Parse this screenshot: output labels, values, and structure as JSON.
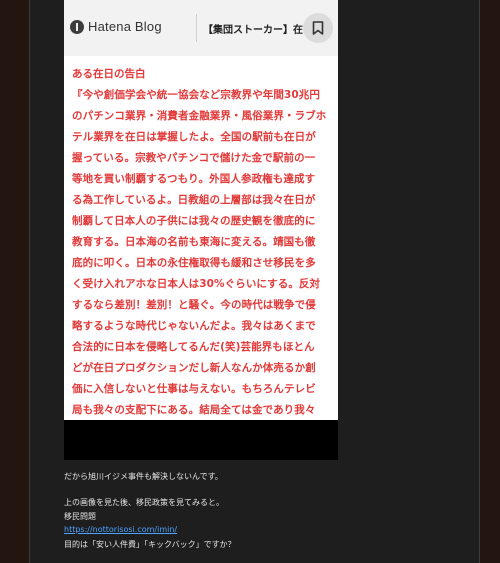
{
  "screenshot": {
    "logo_text": "Hatena Blog",
    "page_title": "【集団ストーカー】在日コ...",
    "notice_title": "ある在日の告白",
    "notice_lines": [
      "『今や創価学会や統一協会など宗教界や年間30兆円",
      "のパチンコ業界・消費者金融業界・風俗業界・ラブホ",
      "テル業界を在日は掌握したよ。全国の駅前も在日が",
      "握っている。宗教やパチンコで儲けた金で駅前の一",
      "等地を買い制覇するつもり。外国人参政権も達成す",
      "る為工作しているよ。日教組の上層部は我々在日が",
      "制覇して日本人の子供には我々の歴史観を徹底的に",
      "教育する。日本海の名前も東海に変える。靖国も徹",
      "底的に叩く。日本の永住権取得も緩和させ移民を多",
      "く受け入れアホな日本人は30%ぐらいにする。反対",
      "するなら差別！差別！と騒ぐ。今の時代は戦争で侵",
      "略するような時代じゃないんだよ。我々はあくまで",
      "合法的に日本を侵略してるんだ(笑)芸能界もほとん",
      "どが在日プロダクションだし新人なんか体売るか創",
      "価に入信しないと仕事は与えない。もちろんテレビ",
      "局も我々の支配下にある。結局全ては金であり我々"
    ]
  },
  "article": {
    "line1": "だから旭川イジメ事件も解決しないんです。",
    "line2": "上の画像を見た後、移民政策を見てみると。",
    "line3": "移民問題",
    "link": "https://nottorisosi.com/imin/",
    "line4": "目的は「安い人件費」「キックバック」ですか？"
  },
  "colors": {
    "text_red": "#e33a3a",
    "link_blue": "#4da3ff",
    "page_bg": "#1e1e1e"
  }
}
